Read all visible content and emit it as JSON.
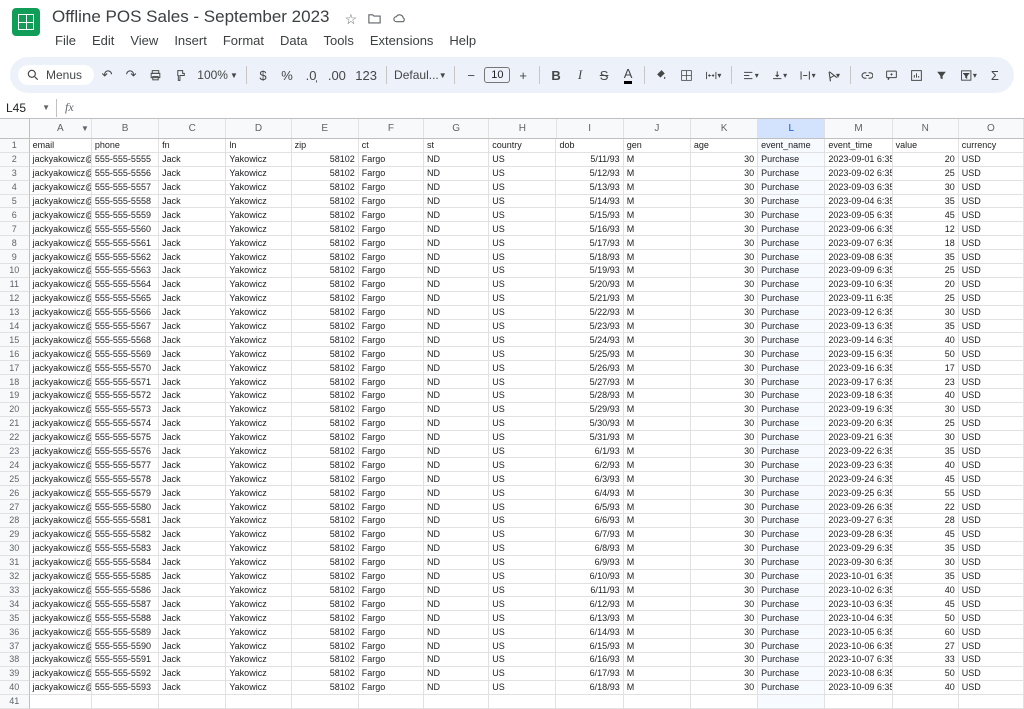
{
  "doc_title": "Offline POS Sales - September 2023",
  "menus": [
    "File",
    "Edit",
    "View",
    "Insert",
    "Format",
    "Data",
    "Tools",
    "Extensions",
    "Help"
  ],
  "menus_label": "Menus",
  "zoom": "100%",
  "font_name": "Defaul...",
  "font_size": "10",
  "name_box": "L45",
  "columns": [
    "A",
    "B",
    "C",
    "D",
    "E",
    "F",
    "G",
    "H",
    "I",
    "J",
    "K",
    "L",
    "M",
    "N",
    "O"
  ],
  "selected_col": "L",
  "header_row": [
    "email",
    "phone",
    "fn",
    "ln",
    "zip",
    "ct",
    "st",
    "country",
    "dob",
    "gen",
    "age",
    "event_name",
    "event_time",
    "value",
    "currency"
  ],
  "rows": [
    {
      "n": 2,
      "email": "jackyakowicz@g",
      "phone": "555-555-5555",
      "fn": "Jack",
      "ln": "Yakowicz",
      "zip": "58102",
      "ct": "Fargo",
      "st": "ND",
      "country": "US",
      "dob": "5/11/93",
      "gen": "M",
      "age": "30",
      "event": "Purchase",
      "time": "2023-09-01 6:35",
      "value": "20",
      "cur": "USD"
    },
    {
      "n": 3,
      "email": "jackyakowicz@g",
      "phone": "555-555-5556",
      "fn": "Jack",
      "ln": "Yakowicz",
      "zip": "58102",
      "ct": "Fargo",
      "st": "ND",
      "country": "US",
      "dob": "5/12/93",
      "gen": "M",
      "age": "30",
      "event": "Purchase",
      "time": "2023-09-02 6:35",
      "value": "25",
      "cur": "USD"
    },
    {
      "n": 4,
      "email": "jackyakowicz@g",
      "phone": "555-555-5557",
      "fn": "Jack",
      "ln": "Yakowicz",
      "zip": "58102",
      "ct": "Fargo",
      "st": "ND",
      "country": "US",
      "dob": "5/13/93",
      "gen": "M",
      "age": "30",
      "event": "Purchase",
      "time": "2023-09-03 6:35",
      "value": "30",
      "cur": "USD"
    },
    {
      "n": 5,
      "email": "jackyakowicz@g",
      "phone": "555-555-5558",
      "fn": "Jack",
      "ln": "Yakowicz",
      "zip": "58102",
      "ct": "Fargo",
      "st": "ND",
      "country": "US",
      "dob": "5/14/93",
      "gen": "M",
      "age": "30",
      "event": "Purchase",
      "time": "2023-09-04 6:35",
      "value": "35",
      "cur": "USD"
    },
    {
      "n": 6,
      "email": "jackyakowicz@g",
      "phone": "555-555-5559",
      "fn": "Jack",
      "ln": "Yakowicz",
      "zip": "58102",
      "ct": "Fargo",
      "st": "ND",
      "country": "US",
      "dob": "5/15/93",
      "gen": "M",
      "age": "30",
      "event": "Purchase",
      "time": "2023-09-05 6:35",
      "value": "45",
      "cur": "USD"
    },
    {
      "n": 7,
      "email": "jackyakowicz@g",
      "phone": "555-555-5560",
      "fn": "Jack",
      "ln": "Yakowicz",
      "zip": "58102",
      "ct": "Fargo",
      "st": "ND",
      "country": "US",
      "dob": "5/16/93",
      "gen": "M",
      "age": "30",
      "event": "Purchase",
      "time": "2023-09-06 6:35",
      "value": "12",
      "cur": "USD"
    },
    {
      "n": 8,
      "email": "jackyakowicz@g",
      "phone": "555-555-5561",
      "fn": "Jack",
      "ln": "Yakowicz",
      "zip": "58102",
      "ct": "Fargo",
      "st": "ND",
      "country": "US",
      "dob": "5/17/93",
      "gen": "M",
      "age": "30",
      "event": "Purchase",
      "time": "2023-09-07 6:35",
      "value": "18",
      "cur": "USD"
    },
    {
      "n": 9,
      "email": "jackyakowicz@g",
      "phone": "555-555-5562",
      "fn": "Jack",
      "ln": "Yakowicz",
      "zip": "58102",
      "ct": "Fargo",
      "st": "ND",
      "country": "US",
      "dob": "5/18/93",
      "gen": "M",
      "age": "30",
      "event": "Purchase",
      "time": "2023-09-08 6:35",
      "value": "35",
      "cur": "USD"
    },
    {
      "n": 10,
      "email": "jackyakowicz@g",
      "phone": "555-555-5563",
      "fn": "Jack",
      "ln": "Yakowicz",
      "zip": "58102",
      "ct": "Fargo",
      "st": "ND",
      "country": "US",
      "dob": "5/19/93",
      "gen": "M",
      "age": "30",
      "event": "Purchase",
      "time": "2023-09-09 6:35",
      "value": "25",
      "cur": "USD"
    },
    {
      "n": 11,
      "email": "jackyakowicz@g",
      "phone": "555-555-5564",
      "fn": "Jack",
      "ln": "Yakowicz",
      "zip": "58102",
      "ct": "Fargo",
      "st": "ND",
      "country": "US",
      "dob": "5/20/93",
      "gen": "M",
      "age": "30",
      "event": "Purchase",
      "time": "2023-09-10 6:35",
      "value": "20",
      "cur": "USD"
    },
    {
      "n": 12,
      "email": "jackyakowicz@g",
      "phone": "555-555-5565",
      "fn": "Jack",
      "ln": "Yakowicz",
      "zip": "58102",
      "ct": "Fargo",
      "st": "ND",
      "country": "US",
      "dob": "5/21/93",
      "gen": "M",
      "age": "30",
      "event": "Purchase",
      "time": "2023-09-11 6:35",
      "value": "25",
      "cur": "USD"
    },
    {
      "n": 13,
      "email": "jackyakowicz@g",
      "phone": "555-555-5566",
      "fn": "Jack",
      "ln": "Yakowicz",
      "zip": "58102",
      "ct": "Fargo",
      "st": "ND",
      "country": "US",
      "dob": "5/22/93",
      "gen": "M",
      "age": "30",
      "event": "Purchase",
      "time": "2023-09-12 6:35",
      "value": "30",
      "cur": "USD"
    },
    {
      "n": 14,
      "email": "jackyakowicz@g",
      "phone": "555-555-5567",
      "fn": "Jack",
      "ln": "Yakowicz",
      "zip": "58102",
      "ct": "Fargo",
      "st": "ND",
      "country": "US",
      "dob": "5/23/93",
      "gen": "M",
      "age": "30",
      "event": "Purchase",
      "time": "2023-09-13 6:35",
      "value": "35",
      "cur": "USD"
    },
    {
      "n": 15,
      "email": "jackyakowicz@g",
      "phone": "555-555-5568",
      "fn": "Jack",
      "ln": "Yakowicz",
      "zip": "58102",
      "ct": "Fargo",
      "st": "ND",
      "country": "US",
      "dob": "5/24/93",
      "gen": "M",
      "age": "30",
      "event": "Purchase",
      "time": "2023-09-14 6:35",
      "value": "40",
      "cur": "USD"
    },
    {
      "n": 16,
      "email": "jackyakowicz@g",
      "phone": "555-555-5569",
      "fn": "Jack",
      "ln": "Yakowicz",
      "zip": "58102",
      "ct": "Fargo",
      "st": "ND",
      "country": "US",
      "dob": "5/25/93",
      "gen": "M",
      "age": "30",
      "event": "Purchase",
      "time": "2023-09-15 6:35",
      "value": "50",
      "cur": "USD"
    },
    {
      "n": 17,
      "email": "jackyakowicz@g",
      "phone": "555-555-5570",
      "fn": "Jack",
      "ln": "Yakowicz",
      "zip": "58102",
      "ct": "Fargo",
      "st": "ND",
      "country": "US",
      "dob": "5/26/93",
      "gen": "M",
      "age": "30",
      "event": "Purchase",
      "time": "2023-09-16 6:35",
      "value": "17",
      "cur": "USD"
    },
    {
      "n": 18,
      "email": "jackyakowicz@g",
      "phone": "555-555-5571",
      "fn": "Jack",
      "ln": "Yakowicz",
      "zip": "58102",
      "ct": "Fargo",
      "st": "ND",
      "country": "US",
      "dob": "5/27/93",
      "gen": "M",
      "age": "30",
      "event": "Purchase",
      "time": "2023-09-17 6:35",
      "value": "23",
      "cur": "USD"
    },
    {
      "n": 19,
      "email": "jackyakowicz@g",
      "phone": "555-555-5572",
      "fn": "Jack",
      "ln": "Yakowicz",
      "zip": "58102",
      "ct": "Fargo",
      "st": "ND",
      "country": "US",
      "dob": "5/28/93",
      "gen": "M",
      "age": "30",
      "event": "Purchase",
      "time": "2023-09-18 6:35",
      "value": "40",
      "cur": "USD"
    },
    {
      "n": 20,
      "email": "jackyakowicz@g",
      "phone": "555-555-5573",
      "fn": "Jack",
      "ln": "Yakowicz",
      "zip": "58102",
      "ct": "Fargo",
      "st": "ND",
      "country": "US",
      "dob": "5/29/93",
      "gen": "M",
      "age": "30",
      "event": "Purchase",
      "time": "2023-09-19 6:35",
      "value": "30",
      "cur": "USD"
    },
    {
      "n": 21,
      "email": "jackyakowicz@g",
      "phone": "555-555-5574",
      "fn": "Jack",
      "ln": "Yakowicz",
      "zip": "58102",
      "ct": "Fargo",
      "st": "ND",
      "country": "US",
      "dob": "5/30/93",
      "gen": "M",
      "age": "30",
      "event": "Purchase",
      "time": "2023-09-20 6:35",
      "value": "25",
      "cur": "USD"
    },
    {
      "n": 22,
      "email": "jackyakowicz@g",
      "phone": "555-555-5575",
      "fn": "Jack",
      "ln": "Yakowicz",
      "zip": "58102",
      "ct": "Fargo",
      "st": "ND",
      "country": "US",
      "dob": "5/31/93",
      "gen": "M",
      "age": "30",
      "event": "Purchase",
      "time": "2023-09-21 6:35",
      "value": "30",
      "cur": "USD"
    },
    {
      "n": 23,
      "email": "jackyakowicz@g",
      "phone": "555-555-5576",
      "fn": "Jack",
      "ln": "Yakowicz",
      "zip": "58102",
      "ct": "Fargo",
      "st": "ND",
      "country": "US",
      "dob": "6/1/93",
      "gen": "M",
      "age": "30",
      "event": "Purchase",
      "time": "2023-09-22 6:35",
      "value": "35",
      "cur": "USD"
    },
    {
      "n": 24,
      "email": "jackyakowicz@g",
      "phone": "555-555-5577",
      "fn": "Jack",
      "ln": "Yakowicz",
      "zip": "58102",
      "ct": "Fargo",
      "st": "ND",
      "country": "US",
      "dob": "6/2/93",
      "gen": "M",
      "age": "30",
      "event": "Purchase",
      "time": "2023-09-23 6:35",
      "value": "40",
      "cur": "USD"
    },
    {
      "n": 25,
      "email": "jackyakowicz@g",
      "phone": "555-555-5578",
      "fn": "Jack",
      "ln": "Yakowicz",
      "zip": "58102",
      "ct": "Fargo",
      "st": "ND",
      "country": "US",
      "dob": "6/3/93",
      "gen": "M",
      "age": "30",
      "event": "Purchase",
      "time": "2023-09-24 6:35",
      "value": "45",
      "cur": "USD"
    },
    {
      "n": 26,
      "email": "jackyakowicz@g",
      "phone": "555-555-5579",
      "fn": "Jack",
      "ln": "Yakowicz",
      "zip": "58102",
      "ct": "Fargo",
      "st": "ND",
      "country": "US",
      "dob": "6/4/93",
      "gen": "M",
      "age": "30",
      "event": "Purchase",
      "time": "2023-09-25 6:35",
      "value": "55",
      "cur": "USD"
    },
    {
      "n": 27,
      "email": "jackyakowicz@g",
      "phone": "555-555-5580",
      "fn": "Jack",
      "ln": "Yakowicz",
      "zip": "58102",
      "ct": "Fargo",
      "st": "ND",
      "country": "US",
      "dob": "6/5/93",
      "gen": "M",
      "age": "30",
      "event": "Purchase",
      "time": "2023-09-26 6:35",
      "value": "22",
      "cur": "USD"
    },
    {
      "n": 28,
      "email": "jackyakowicz@g",
      "phone": "555-555-5581",
      "fn": "Jack",
      "ln": "Yakowicz",
      "zip": "58102",
      "ct": "Fargo",
      "st": "ND",
      "country": "US",
      "dob": "6/6/93",
      "gen": "M",
      "age": "30",
      "event": "Purchase",
      "time": "2023-09-27 6:35",
      "value": "28",
      "cur": "USD"
    },
    {
      "n": 29,
      "email": "jackyakowicz@g",
      "phone": "555-555-5582",
      "fn": "Jack",
      "ln": "Yakowicz",
      "zip": "58102",
      "ct": "Fargo",
      "st": "ND",
      "country": "US",
      "dob": "6/7/93",
      "gen": "M",
      "age": "30",
      "event": "Purchase",
      "time": "2023-09-28 6:35",
      "value": "45",
      "cur": "USD"
    },
    {
      "n": 30,
      "email": "jackyakowicz@g",
      "phone": "555-555-5583",
      "fn": "Jack",
      "ln": "Yakowicz",
      "zip": "58102",
      "ct": "Fargo",
      "st": "ND",
      "country": "US",
      "dob": "6/8/93",
      "gen": "M",
      "age": "30",
      "event": "Purchase",
      "time": "2023-09-29 6:35",
      "value": "35",
      "cur": "USD"
    },
    {
      "n": 31,
      "email": "jackyakowicz@g",
      "phone": "555-555-5584",
      "fn": "Jack",
      "ln": "Yakowicz",
      "zip": "58102",
      "ct": "Fargo",
      "st": "ND",
      "country": "US",
      "dob": "6/9/93",
      "gen": "M",
      "age": "30",
      "event": "Purchase",
      "time": "2023-09-30 6:35",
      "value": "30",
      "cur": "USD"
    },
    {
      "n": 32,
      "email": "jackyakowicz@g",
      "phone": "555-555-5585",
      "fn": "Jack",
      "ln": "Yakowicz",
      "zip": "58102",
      "ct": "Fargo",
      "st": "ND",
      "country": "US",
      "dob": "6/10/93",
      "gen": "M",
      "age": "30",
      "event": "Purchase",
      "time": "2023-10-01 6:35",
      "value": "35",
      "cur": "USD"
    },
    {
      "n": 33,
      "email": "jackyakowicz@g",
      "phone": "555-555-5586",
      "fn": "Jack",
      "ln": "Yakowicz",
      "zip": "58102",
      "ct": "Fargo",
      "st": "ND",
      "country": "US",
      "dob": "6/11/93",
      "gen": "M",
      "age": "30",
      "event": "Purchase",
      "time": "2023-10-02 6:35",
      "value": "40",
      "cur": "USD"
    },
    {
      "n": 34,
      "email": "jackyakowicz@g",
      "phone": "555-555-5587",
      "fn": "Jack",
      "ln": "Yakowicz",
      "zip": "58102",
      "ct": "Fargo",
      "st": "ND",
      "country": "US",
      "dob": "6/12/93",
      "gen": "M",
      "age": "30",
      "event": "Purchase",
      "time": "2023-10-03 6:35",
      "value": "45",
      "cur": "USD"
    },
    {
      "n": 35,
      "email": "jackyakowicz@g",
      "phone": "555-555-5588",
      "fn": "Jack",
      "ln": "Yakowicz",
      "zip": "58102",
      "ct": "Fargo",
      "st": "ND",
      "country": "US",
      "dob": "6/13/93",
      "gen": "M",
      "age": "30",
      "event": "Purchase",
      "time": "2023-10-04 6:35",
      "value": "50",
      "cur": "USD"
    },
    {
      "n": 36,
      "email": "jackyakowicz@g",
      "phone": "555-555-5589",
      "fn": "Jack",
      "ln": "Yakowicz",
      "zip": "58102",
      "ct": "Fargo",
      "st": "ND",
      "country": "US",
      "dob": "6/14/93",
      "gen": "M",
      "age": "30",
      "event": "Purchase",
      "time": "2023-10-05 6:35",
      "value": "60",
      "cur": "USD"
    },
    {
      "n": 37,
      "email": "jackyakowicz@g",
      "phone": "555-555-5590",
      "fn": "Jack",
      "ln": "Yakowicz",
      "zip": "58102",
      "ct": "Fargo",
      "st": "ND",
      "country": "US",
      "dob": "6/15/93",
      "gen": "M",
      "age": "30",
      "event": "Purchase",
      "time": "2023-10-06 6:35",
      "value": "27",
      "cur": "USD"
    },
    {
      "n": 38,
      "email": "jackyakowicz@g",
      "phone": "555-555-5591",
      "fn": "Jack",
      "ln": "Yakowicz",
      "zip": "58102",
      "ct": "Fargo",
      "st": "ND",
      "country": "US",
      "dob": "6/16/93",
      "gen": "M",
      "age": "30",
      "event": "Purchase",
      "time": "2023-10-07 6:35",
      "value": "33",
      "cur": "USD"
    },
    {
      "n": 39,
      "email": "jackyakowicz@g",
      "phone": "555-555-5592",
      "fn": "Jack",
      "ln": "Yakowicz",
      "zip": "58102",
      "ct": "Fargo",
      "st": "ND",
      "country": "US",
      "dob": "6/17/93",
      "gen": "M",
      "age": "30",
      "event": "Purchase",
      "time": "2023-10-08 6:35",
      "value": "50",
      "cur": "USD"
    },
    {
      "n": 40,
      "email": "jackyakowicz@g",
      "phone": "555-555-5593",
      "fn": "Jack",
      "ln": "Yakowicz",
      "zip": "58102",
      "ct": "Fargo",
      "st": "ND",
      "country": "US",
      "dob": "6/18/93",
      "gen": "M",
      "age": "30",
      "event": "Purchase",
      "time": "2023-10-09 6:35",
      "value": "40",
      "cur": "USD"
    }
  ],
  "empty_row": 41
}
